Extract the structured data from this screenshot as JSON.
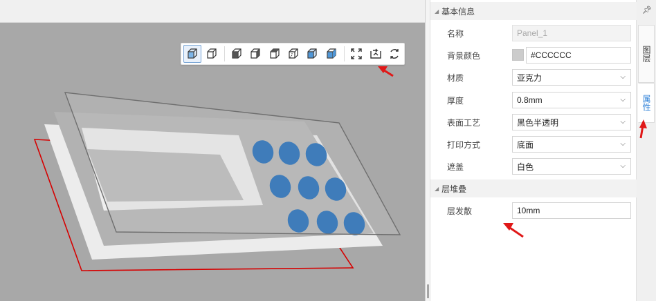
{
  "toolbar": {
    "views": [
      {
        "name": "view-3d-iso-icon",
        "active": true
      },
      {
        "name": "view-3d-wire-icon",
        "active": false
      },
      {
        "name": "view-front-icon",
        "active": false
      },
      {
        "name": "view-back-icon",
        "active": false
      },
      {
        "name": "view-left-icon",
        "active": false
      },
      {
        "name": "view-right-icon",
        "active": false
      },
      {
        "name": "view-top-icon",
        "active": false
      },
      {
        "name": "view-bottom-icon",
        "active": false
      }
    ],
    "actions": [
      "fit-view-icon",
      "export-icon",
      "refresh-icon"
    ]
  },
  "panel": {
    "section_basic": "基本信息",
    "section_stack": "层堆叠",
    "name_label": "名称",
    "name_value": "Panel_1",
    "bg_label": "背景颜色",
    "bg_value": "#CCCCCC",
    "bg_color": "#cccccc",
    "material_label": "材质",
    "material_value": "亚克力",
    "thickness_label": "厚度",
    "thickness_value": "0.8mm",
    "surface_label": "表面工艺",
    "surface_value": "黑色半透明",
    "print_label": "打印方式",
    "print_value": "底面",
    "mask_label": "遮盖",
    "mask_value": "白色",
    "spread_label": "层发散",
    "spread_value": "10mm"
  },
  "side_tabs": {
    "layers": "图层",
    "properties": "属性"
  },
  "colors": {
    "viewport_bg": "#a8a8a8",
    "button_blue": "#0a5fb4",
    "outline_red": "#d60000",
    "accent_blue": "#2b7fd8",
    "arrow_red": "#e01818"
  }
}
